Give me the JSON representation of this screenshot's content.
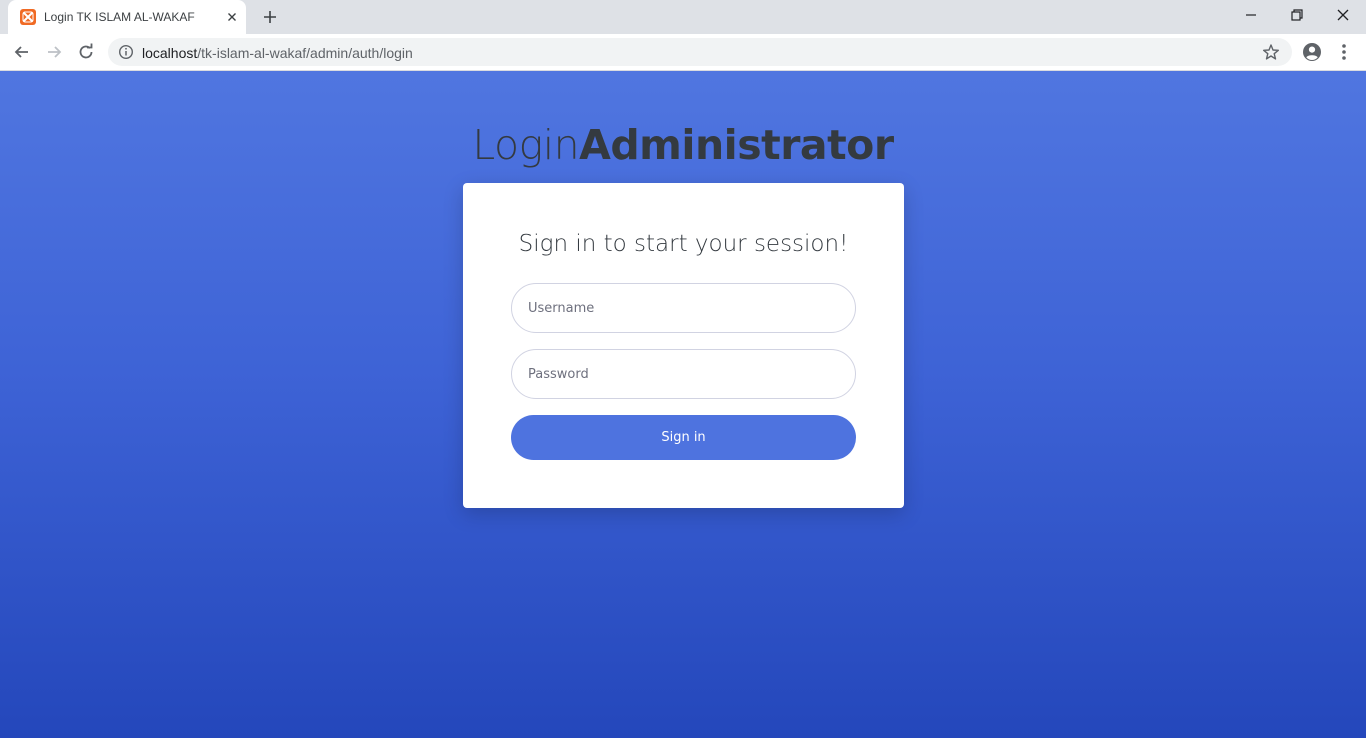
{
  "browser": {
    "tab": {
      "title": "Login TK ISLAM AL-WAKAF",
      "favicon": "xampp-icon"
    },
    "address": {
      "host": "localhost",
      "path": "/tk-islam-al-wakaf/admin/auth/login"
    }
  },
  "page": {
    "heading_light": "Login",
    "heading_bold": "Administrator",
    "card_title": "Sign in to start your session!",
    "username_placeholder": "Username",
    "password_placeholder": "Password",
    "signin_label": "Sign in"
  },
  "colors": {
    "accent": "#4e73df",
    "background_top": "#5076e0",
    "background_bottom": "#2447bb"
  }
}
